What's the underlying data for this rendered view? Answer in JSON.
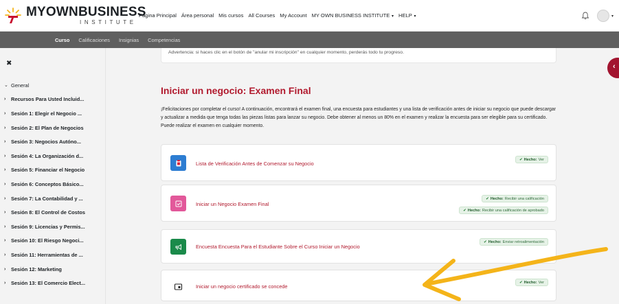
{
  "brand": {
    "name_part1": "MYOWN",
    "name_part2": "BUSINESS",
    "subtitle": "INSTITUTE"
  },
  "nav": {
    "items": [
      "Página Principal",
      "Área personal",
      "Mis cursos",
      "All Courses",
      "My Account"
    ],
    "dropdown1": "MY OWN BUSINESS INSTITUTE",
    "dropdown2": "HELP"
  },
  "subnav": {
    "tabs": [
      "Curso",
      "Calificaciones",
      "Insignias",
      "Competencias"
    ],
    "active": "Curso"
  },
  "sidebar": {
    "items": [
      "General",
      "Recursos Para Usted Incluid...",
      "Sesión 1: Elegir el Negocio ...",
      "Sesión 2: El Plan de Negocios",
      "Sesión 3: Negocios Autóno...",
      "Sesión 4: La Organización d...",
      "Sesión 5: Financiar el Negocio",
      "Sesión 6: Conceptos Básico...",
      "Sesión 7: La Contabilidad y ...",
      "Sesión 8: El Control de Costos",
      "Sesión 9: Licencias y Permis...",
      "Sesión 10: El Riesgo Negoci...",
      "Sesión 11: Herramientas de ...",
      "Sesión 12: Marketing",
      "Sesión 13: El Comercio Elect..."
    ]
  },
  "main": {
    "warning": "Advertencia: si haces clic en el botón de \"anular mi inscripción\" en cualquier momento, perderás todo tu progreso.",
    "title": "Iniciar un negocio: Examen Final",
    "description": "¡Felicitaciones por completar el curso! A continuación, encontrará el examen final, una encuesta para estudiantes y una lista de verificación antes de iniciar su negocio que puede descargar y actualizar a medida que tenga todas las piezas listas para lanzar su negocio. Debe obtener al menos un 80% en el examen y realizar la encuesta para ser elegible para su certificado. Puede realizar el examen en cualquier momento.",
    "activities": [
      {
        "name": "Lista de Verificación Antes de Comenzar su Negocio",
        "icon": "checklist-icon",
        "color": "#2d7dd2",
        "badges": [
          {
            "label": "Hecho:",
            "text": "Ver"
          }
        ]
      },
      {
        "name": "Iniciar un Negocio Examen Final",
        "icon": "quiz-icon",
        "color": "#e2589a",
        "badges": [
          {
            "label": "Hecho:",
            "text": "Recibir una calificación"
          },
          {
            "label": "Hecho:",
            "text": "Recibir una calificación de aprobado"
          }
        ]
      },
      {
        "name": "Encuesta Encuesta Para el Estudiante Sobre el Curso Iniciar un Negocio",
        "icon": "megaphone-icon",
        "color": "#1a8a4a",
        "badges": [
          {
            "label": "Hecho:",
            "text": "Enviar retroalimentación"
          }
        ]
      },
      {
        "name": "Iniciar un negocio certificado se concede",
        "icon": "certificate-icon",
        "color": "#ffffff",
        "badges": [
          {
            "label": "Hecho:",
            "text": "Ver"
          }
        ]
      }
    ]
  },
  "colors": {
    "accent": "#b11a2e",
    "annotation": "#f4b41a",
    "subbar": "#5f5f5f"
  }
}
